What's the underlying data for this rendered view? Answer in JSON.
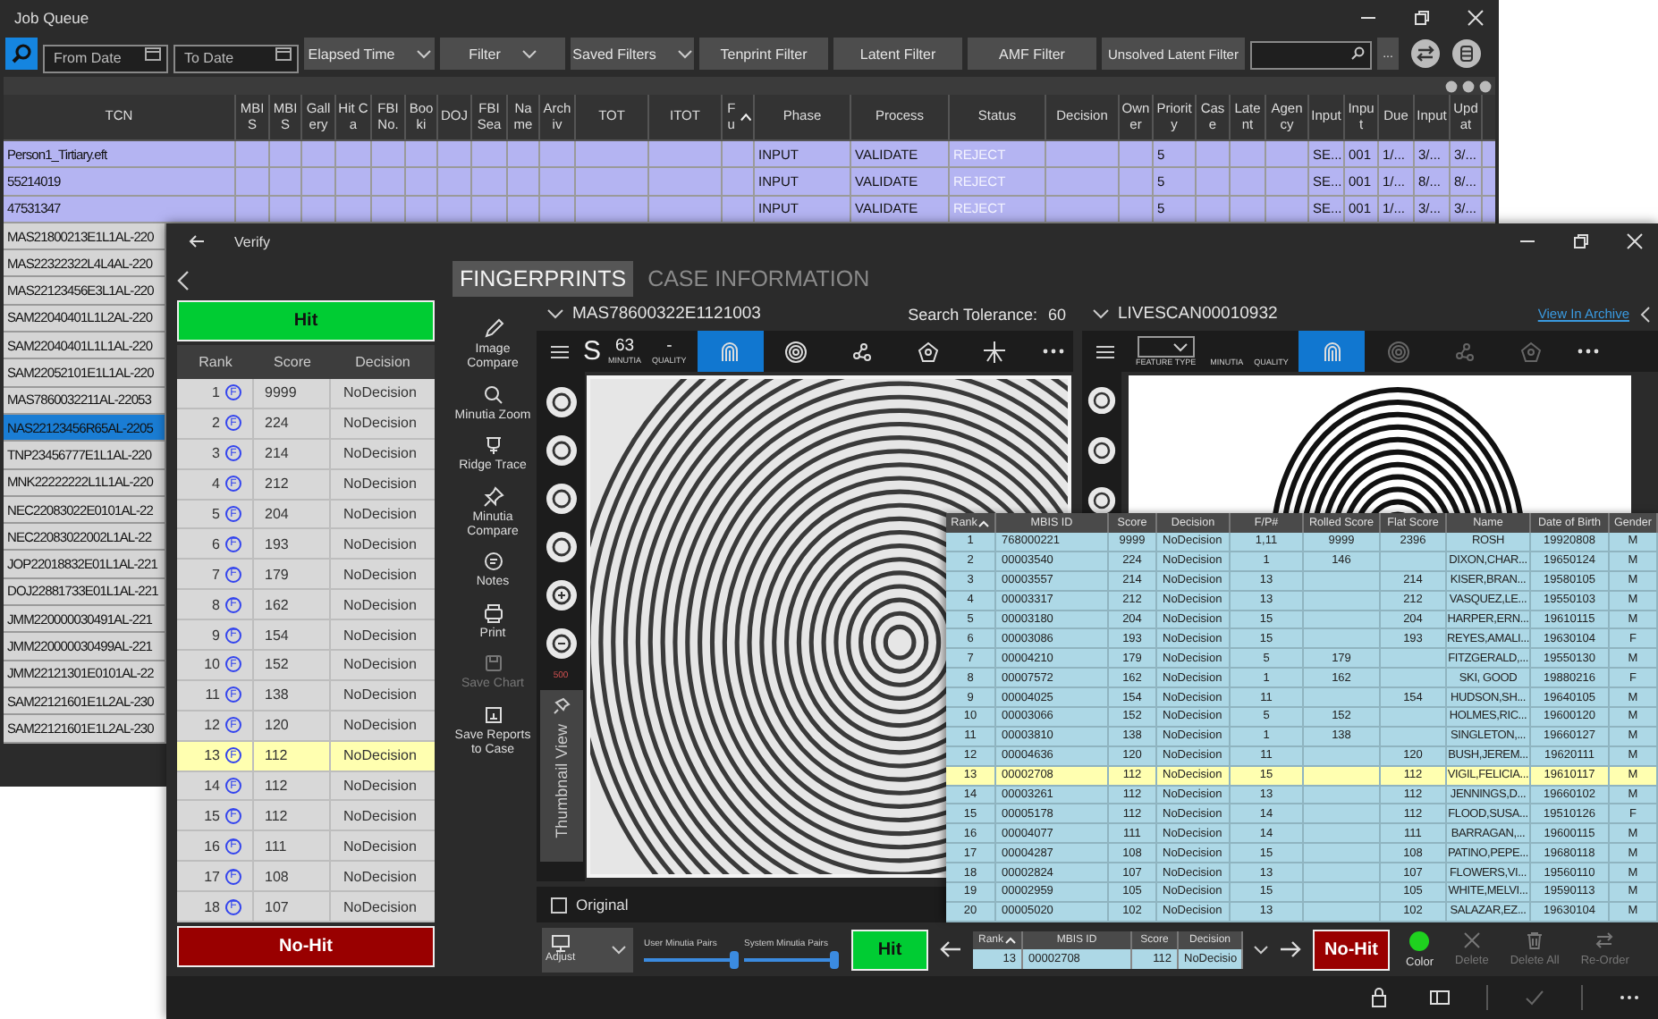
{
  "job_queue": {
    "title": "Job Queue",
    "toolbar": {
      "from_date": {
        "placeholder": "From Date"
      },
      "to_date": {
        "placeholder": "To Date"
      },
      "dropdowns": [
        "Elapsed Time",
        "Filter",
        "Saved Filters"
      ],
      "buttons": [
        "Tenprint Filter",
        "Latent Filter",
        "AMF Filter",
        "Unsolved Latent Filter"
      ],
      "more_button": "..."
    },
    "columns": [
      {
        "label": "TCN",
        "sorted": false
      },
      {
        "label": "MBIS",
        "sorted": false
      },
      {
        "label": "MBIS",
        "sorted": false
      },
      {
        "label": "Gallery",
        "sorted": false
      },
      {
        "label": "Hit Ca",
        "sorted": false
      },
      {
        "label": "FBI No.",
        "sorted": false
      },
      {
        "label": "Booki",
        "sorted": false
      },
      {
        "label": "DOJ",
        "sorted": false
      },
      {
        "label": "FBI Sea",
        "sorted": false
      },
      {
        "label": "Name",
        "sorted": false
      },
      {
        "label": "Archiv",
        "sorted": false
      },
      {
        "label": "TOT",
        "sorted": false
      },
      {
        "label": "ITOT",
        "sorted": false
      },
      {
        "label": "Fu",
        "sorted": true
      },
      {
        "label": "Phase",
        "sorted": false
      },
      {
        "label": "Process",
        "sorted": false
      },
      {
        "label": "Status",
        "sorted": false
      },
      {
        "label": "Decision",
        "sorted": false
      },
      {
        "label": "Owner",
        "sorted": false
      },
      {
        "label": "Priority",
        "sorted": false
      },
      {
        "label": "Case",
        "sorted": false
      },
      {
        "label": "Latent",
        "sorted": false
      },
      {
        "label": "Agency",
        "sorted": false
      },
      {
        "label": "Input",
        "sorted": false
      },
      {
        "label": "Input",
        "sorted": false
      },
      {
        "label": "Due",
        "sorted": false
      },
      {
        "label": "Input",
        "sorted": false
      },
      {
        "label": "Updat",
        "sorted": false
      }
    ],
    "rows": [
      {
        "highlighted": true,
        "selected": false,
        "cells": {
          "tcn": "Person1_Tirtiary.eft",
          "phase": "INPUT",
          "process": "VALIDATE",
          "status": "REJECT",
          "priority": "5",
          "input_a": "SE...",
          "input_b": "001",
          "due": "1/...",
          "input_c": "3/...",
          "updat": "3/..."
        }
      },
      {
        "highlighted": true,
        "selected": false,
        "cells": {
          "tcn": "55214019",
          "phase": "INPUT",
          "process": "VALIDATE",
          "status": "REJECT",
          "priority": "5",
          "input_a": "SE...",
          "input_b": "001",
          "due": "1/...",
          "input_c": "8/...",
          "updat": "8/..."
        }
      },
      {
        "highlighted": true,
        "selected": false,
        "cells": {
          "tcn": "47531347",
          "phase": "INPUT",
          "process": "VALIDATE",
          "status": "REJECT",
          "priority": "5",
          "input_a": "SE...",
          "input_b": "001",
          "due": "1/...",
          "input_c": "3/...",
          "updat": "3/..."
        }
      },
      {
        "highlighted": false,
        "selected": false,
        "cells": {
          "tcn": "MAS21800213E1L1AL-220"
        }
      },
      {
        "highlighted": false,
        "selected": false,
        "cells": {
          "tcn": "MAS22322322L4L4AL-220"
        }
      },
      {
        "highlighted": false,
        "selected": false,
        "cells": {
          "tcn": "MAS22123456E3L1AL-220"
        }
      },
      {
        "highlighted": false,
        "selected": false,
        "cells": {
          "tcn": "SAM22040401L1L2AL-220"
        }
      },
      {
        "highlighted": false,
        "selected": false,
        "cells": {
          "tcn": "SAM22040401L1L1AL-220"
        }
      },
      {
        "highlighted": false,
        "selected": false,
        "cells": {
          "tcn": "SAM22052101E1L1AL-220"
        }
      },
      {
        "highlighted": false,
        "selected": false,
        "cells": {
          "tcn": "MAS7860032211AL-22053"
        }
      },
      {
        "highlighted": false,
        "selected": true,
        "cells": {
          "tcn": "NAS22123456R65AL-2205"
        }
      },
      {
        "highlighted": false,
        "selected": false,
        "cells": {
          "tcn": "TNP23456777E1L1AL-220"
        }
      },
      {
        "highlighted": false,
        "selected": false,
        "cells": {
          "tcn": "MNK22222222L1L1AL-220"
        }
      },
      {
        "highlighted": false,
        "selected": false,
        "cells": {
          "tcn": "NEC22083022E0101AL-22"
        }
      },
      {
        "highlighted": false,
        "selected": false,
        "cells": {
          "tcn": "NEC22083022002L1AL-22"
        }
      },
      {
        "highlighted": false,
        "selected": false,
        "cells": {
          "tcn": "JOP22018832E01L1AL-221"
        }
      },
      {
        "highlighted": false,
        "selected": false,
        "cells": {
          "tcn": "DOJ22881733E01L1AL-221"
        }
      },
      {
        "highlighted": false,
        "selected": false,
        "cells": {
          "tcn": "JMM220000030491AL-221"
        }
      },
      {
        "highlighted": false,
        "selected": false,
        "cells": {
          "tcn": "JMM220000030499AL-221"
        }
      },
      {
        "highlighted": false,
        "selected": false,
        "cells": {
          "tcn": "JMM22121301E0101AL-22"
        }
      },
      {
        "highlighted": false,
        "selected": false,
        "cells": {
          "tcn": "SAM22121601E1L2AL-230"
        }
      },
      {
        "highlighted": false,
        "selected": false,
        "cells": {
          "tcn": "SAM22121601E1L2AL-230"
        }
      }
    ]
  },
  "verify": {
    "title": "Verify",
    "hit_button": "Hit",
    "no_hit_button": "No-Hit",
    "rank_table": {
      "columns": [
        "Rank",
        "Score",
        "Decision"
      ],
      "rows": [
        {
          "rank": "1",
          "badge": "F",
          "score": "9999",
          "decision": "NoDecision",
          "selected": false
        },
        {
          "rank": "2",
          "badge": "F",
          "score": "224",
          "decision": "NoDecision",
          "selected": false
        },
        {
          "rank": "3",
          "badge": "F",
          "score": "214",
          "decision": "NoDecision",
          "selected": false
        },
        {
          "rank": "4",
          "badge": "F",
          "score": "212",
          "decision": "NoDecision",
          "selected": false
        },
        {
          "rank": "5",
          "badge": "F",
          "score": "204",
          "decision": "NoDecision",
          "selected": false
        },
        {
          "rank": "6",
          "badge": "F",
          "score": "193",
          "decision": "NoDecision",
          "selected": false
        },
        {
          "rank": "7",
          "badge": "F",
          "score": "179",
          "decision": "NoDecision",
          "selected": false
        },
        {
          "rank": "8",
          "badge": "F",
          "score": "162",
          "decision": "NoDecision",
          "selected": false
        },
        {
          "rank": "9",
          "badge": "F",
          "score": "154",
          "decision": "NoDecision",
          "selected": false
        },
        {
          "rank": "10",
          "badge": "F",
          "score": "152",
          "decision": "NoDecision",
          "selected": false
        },
        {
          "rank": "11",
          "badge": "F",
          "score": "138",
          "decision": "NoDecision",
          "selected": false
        },
        {
          "rank": "12",
          "badge": "F",
          "score": "120",
          "decision": "NoDecision",
          "selected": false
        },
        {
          "rank": "13",
          "badge": "F",
          "score": "112",
          "decision": "NoDecision",
          "selected": true
        },
        {
          "rank": "14",
          "badge": "F",
          "score": "112",
          "decision": "NoDecision",
          "selected": false
        },
        {
          "rank": "15",
          "badge": "F",
          "score": "112",
          "decision": "NoDecision",
          "selected": false
        },
        {
          "rank": "16",
          "badge": "F",
          "score": "111",
          "decision": "NoDecision",
          "selected": false
        },
        {
          "rank": "17",
          "badge": "F",
          "score": "108",
          "decision": "NoDecision",
          "selected": false
        },
        {
          "rank": "18",
          "badge": "F",
          "score": "107",
          "decision": "NoDecision",
          "selected": false
        }
      ]
    },
    "tabs": [
      {
        "label": "FINGERPRINTS",
        "selected": true
      },
      {
        "label": "CASE INFORMATION",
        "selected": false
      }
    ],
    "tools": [
      {
        "label": "Image Compare",
        "kind": "pencil",
        "disabled": false
      },
      {
        "label": "Minutia Zoom",
        "kind": "magnifier",
        "disabled": false
      },
      {
        "label": "Ridge Trace",
        "kind": "ridge",
        "disabled": false
      },
      {
        "label": "Minutia Compare",
        "kind": "pin",
        "disabled": false
      },
      {
        "label": "Notes",
        "kind": "notes",
        "disabled": false
      },
      {
        "label": "Print",
        "kind": "print",
        "disabled": false
      },
      {
        "label": "Save Chart",
        "kind": "save",
        "disabled": true
      },
      {
        "label": "Save Reports to Case",
        "kind": "report",
        "disabled": false
      }
    ],
    "left_pane": {
      "subject": "MAS78600322E1121003",
      "tolerance_label": "Search Tolerance:",
      "tolerance": "60",
      "pattern": "S",
      "minutia": "63",
      "minutia_label": "MINUTIA",
      "quality": "-",
      "quality_label": "QUALITY",
      "view_tools": [
        {
          "kind": "ridges",
          "selected": true,
          "disabled": false
        },
        {
          "kind": "fingerprint",
          "selected": false,
          "disabled": false
        },
        {
          "kind": "nodes",
          "selected": false,
          "disabled": false
        },
        {
          "kind": "polygon",
          "selected": false,
          "disabled": false
        },
        {
          "kind": "star",
          "selected": false,
          "disabled": false
        }
      ],
      "resolution": "500",
      "thumbnail_tab": "Thumbnail View",
      "original": {
        "label": "Original",
        "checked": false
      }
    },
    "right_pane": {
      "subject": "LIVESCAN00010932",
      "link": "View In Archive",
      "feature_type_label": "FEATURE TYPE",
      "minutia_label": "MINUTIA",
      "quality_label": "QUALITY",
      "view_tools": [
        {
          "kind": "ridges",
          "selected": true,
          "disabled": false
        },
        {
          "kind": "fingerprint",
          "selected": false,
          "disabled": true
        },
        {
          "kind": "nodes",
          "selected": false,
          "disabled": true
        },
        {
          "kind": "polygon",
          "selected": false,
          "disabled": true
        }
      ]
    },
    "candidates": {
      "columns": [
        {
          "label": "Rank",
          "sorted": true
        },
        {
          "label": "MBIS ID",
          "sorted": false
        },
        {
          "label": "Score",
          "sorted": false
        },
        {
          "label": "Decision",
          "sorted": false
        },
        {
          "label": "F/P#",
          "sorted": false
        },
        {
          "label": "Rolled Score",
          "sorted": false
        },
        {
          "label": "Flat Score",
          "sorted": false
        },
        {
          "label": "Name",
          "sorted": false
        },
        {
          "label": "Date of Birth",
          "sorted": false
        },
        {
          "label": "Gender",
          "sorted": false
        }
      ],
      "rows": [
        {
          "selected": false,
          "cells": {
            "rank": "1",
            "mbis_id": "768000221",
            "score": "9999",
            "decision": "NoDecision",
            "fp": "1,11",
            "rolled": "9999",
            "flat": "2396",
            "name": "ROSH",
            "dob": "19920808",
            "gender": "M"
          }
        },
        {
          "selected": false,
          "cells": {
            "rank": "2",
            "mbis_id": "00003540",
            "score": "224",
            "decision": "NoDecision",
            "fp": "1",
            "rolled": "146",
            "name": "DIXON,CHAR...",
            "dob": "19650124",
            "gender": "M"
          }
        },
        {
          "selected": false,
          "cells": {
            "rank": "3",
            "mbis_id": "00003557",
            "score": "214",
            "decision": "NoDecision",
            "fp": "13",
            "flat": "214",
            "name": "KISER,BRAN...",
            "dob": "19580105",
            "gender": "M"
          }
        },
        {
          "selected": false,
          "cells": {
            "rank": "4",
            "mbis_id": "00003317",
            "score": "212",
            "decision": "NoDecision",
            "fp": "13",
            "flat": "212",
            "name": "VASQUEZ,LE...",
            "dob": "19550103",
            "gender": "M"
          }
        },
        {
          "selected": false,
          "cells": {
            "rank": "5",
            "mbis_id": "00003180",
            "score": "204",
            "decision": "NoDecision",
            "fp": "15",
            "flat": "204",
            "name": "HARPER,ERN...",
            "dob": "19610115",
            "gender": "M"
          }
        },
        {
          "selected": false,
          "cells": {
            "rank": "6",
            "mbis_id": "00003086",
            "score": "193",
            "decision": "NoDecision",
            "fp": "15",
            "flat": "193",
            "name": "REYES,AMALI...",
            "dob": "19630104",
            "gender": "F"
          }
        },
        {
          "selected": false,
          "cells": {
            "rank": "7",
            "mbis_id": "00004210",
            "score": "179",
            "decision": "NoDecision",
            "fp": "5",
            "rolled": "179",
            "name": "FITZGERALD,...",
            "dob": "19550130",
            "gender": "M"
          }
        },
        {
          "selected": false,
          "cells": {
            "rank": "8",
            "mbis_id": "00007572",
            "score": "162",
            "decision": "NoDecision",
            "fp": "1",
            "rolled": "162",
            "name": "SKI, GOOD",
            "dob": "19880216",
            "gender": "F"
          }
        },
        {
          "selected": false,
          "cells": {
            "rank": "9",
            "mbis_id": "00004025",
            "score": "154",
            "decision": "NoDecision",
            "fp": "11",
            "flat": "154",
            "name": "HUDSON,SH...",
            "dob": "19640105",
            "gender": "M"
          }
        },
        {
          "selected": false,
          "cells": {
            "rank": "10",
            "mbis_id": "00003066",
            "score": "152",
            "decision": "NoDecision",
            "fp": "5",
            "rolled": "152",
            "name": "HOLMES,RIC...",
            "dob": "19600120",
            "gender": "M"
          }
        },
        {
          "selected": false,
          "cells": {
            "rank": "11",
            "mbis_id": "00003810",
            "score": "138",
            "decision": "NoDecision",
            "fp": "1",
            "rolled": "138",
            "name": "SINGLETON,...",
            "dob": "19660127",
            "gender": "M"
          }
        },
        {
          "selected": false,
          "cells": {
            "rank": "12",
            "mbis_id": "00004636",
            "score": "120",
            "decision": "NoDecision",
            "fp": "11",
            "flat": "120",
            "name": "BUSH,JEREM...",
            "dob": "19620111",
            "gender": "M"
          }
        },
        {
          "selected": true,
          "cells": {
            "rank": "13",
            "mbis_id": "00002708",
            "score": "112",
            "decision": "NoDecision",
            "fp": "15",
            "flat": "112",
            "name": "VIGIL,FELICIA...",
            "dob": "19610117",
            "gender": "M"
          }
        },
        {
          "selected": false,
          "cells": {
            "rank": "14",
            "mbis_id": "00003261",
            "score": "112",
            "decision": "NoDecision",
            "fp": "13",
            "flat": "112",
            "name": "JENNINGS,D...",
            "dob": "19660102",
            "gender": "M"
          }
        },
        {
          "selected": false,
          "cells": {
            "rank": "15",
            "mbis_id": "00005178",
            "score": "112",
            "decision": "NoDecision",
            "fp": "14",
            "flat": "112",
            "name": "FLOOD,SUSA...",
            "dob": "19510126",
            "gender": "F"
          }
        },
        {
          "selected": false,
          "cells": {
            "rank": "16",
            "mbis_id": "00004077",
            "score": "111",
            "decision": "NoDecision",
            "fp": "14",
            "flat": "111",
            "name": "BARRAGAN,...",
            "dob": "19600115",
            "gender": "M"
          }
        },
        {
          "selected": false,
          "cells": {
            "rank": "17",
            "mbis_id": "00004287",
            "score": "108",
            "decision": "NoDecision",
            "fp": "15",
            "flat": "108",
            "name": "PATINO,PEPE...",
            "dob": "19680118",
            "gender": "M"
          }
        },
        {
          "selected": false,
          "cells": {
            "rank": "18",
            "mbis_id": "00002824",
            "score": "107",
            "decision": "NoDecision",
            "fp": "13",
            "flat": "107",
            "name": "FLOWERS,VI...",
            "dob": "19560110",
            "gender": "M"
          }
        },
        {
          "selected": false,
          "cells": {
            "rank": "19",
            "mbis_id": "00002959",
            "score": "105",
            "decision": "NoDecision",
            "fp": "15",
            "flat": "105",
            "name": "WHITE,MELVI...",
            "dob": "19590113",
            "gender": "M"
          }
        },
        {
          "selected": false,
          "cells": {
            "rank": "20",
            "mbis_id": "00005020",
            "score": "102",
            "decision": "NoDecision",
            "fp": "13",
            "flat": "102",
            "name": "SALAZAR,EZ...",
            "dob": "19630104",
            "gender": "M"
          }
        }
      ]
    },
    "adjust_button": "Adjust",
    "sliders": [
      {
        "label": "User Minutia Pairs",
        "level": 1
      },
      {
        "label": "System Minutia Pairs",
        "level": 1
      }
    ],
    "bottom_hit_button": "Hit",
    "current_candidate": {
      "columns": [
        {
          "label": "Rank",
          "sorted": true
        },
        {
          "label": "MBIS ID",
          "sorted": false
        },
        {
          "label": "Score",
          "sorted": false
        },
        {
          "label": "Decision",
          "sorted": false
        }
      ],
      "row": [
        "13",
        "00002708",
        "112",
        "NoDecisio"
      ]
    },
    "bottom_no_hit_button": "No-Hit",
    "actions": [
      {
        "label": "Color",
        "kind": "color",
        "color": "#1fd11f",
        "disabled": false
      },
      {
        "label": "Delete",
        "kind": "delete",
        "disabled": true
      },
      {
        "label": "Delete All",
        "kind": "trash",
        "disabled": true
      },
      {
        "label": "Re-Order",
        "kind": "reorder",
        "disabled": true
      }
    ],
    "footer": [
      {
        "kind": "lock",
        "disabled": false
      },
      {
        "kind": "panel",
        "disabled": false
      },
      {
        "kind": "check",
        "disabled": true
      },
      {
        "kind": "more",
        "disabled": false
      }
    ]
  }
}
